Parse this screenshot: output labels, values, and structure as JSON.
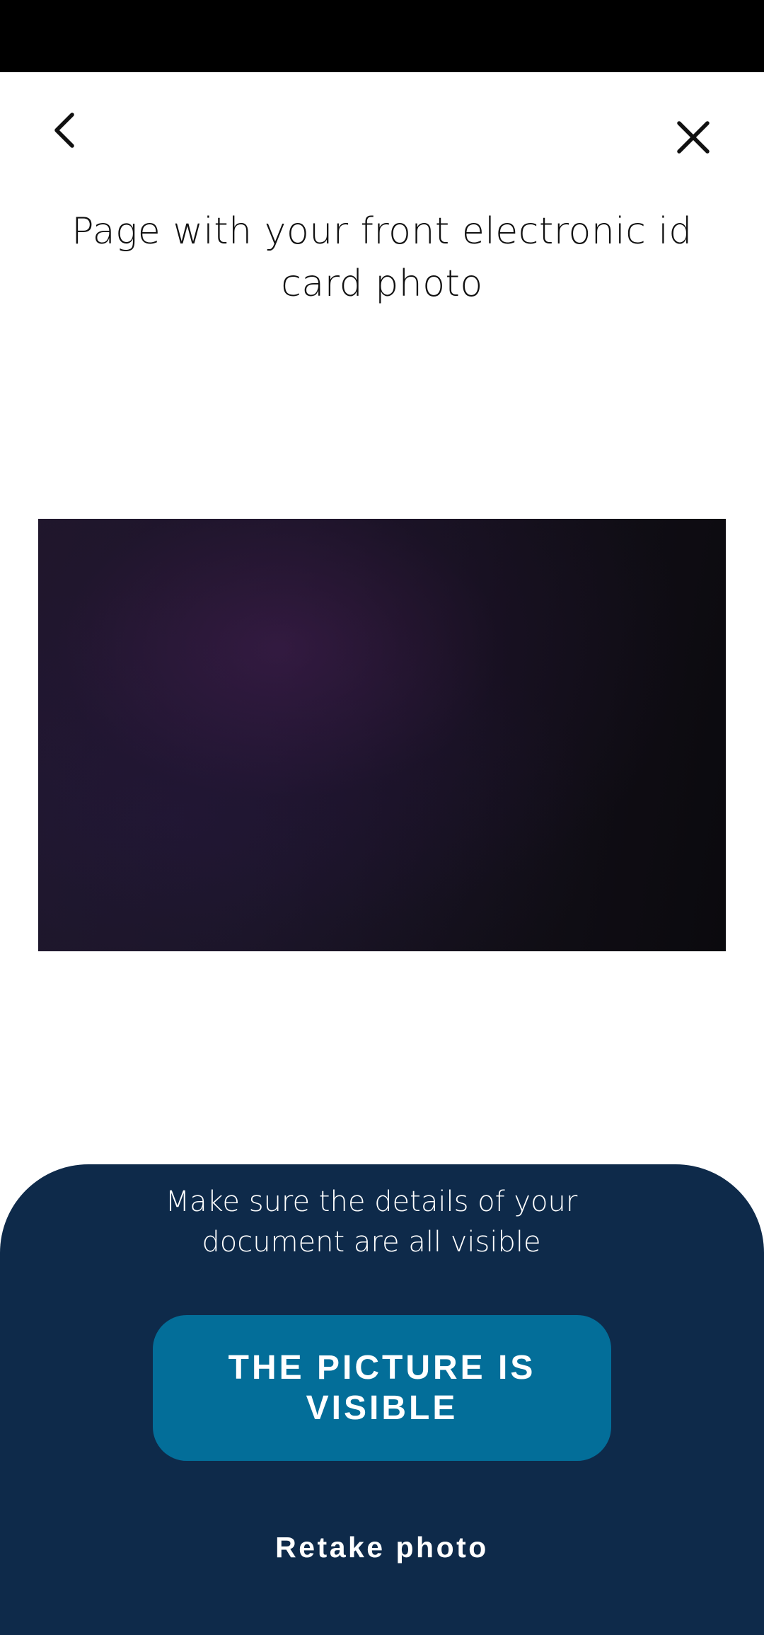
{
  "header": {
    "title": "Page with your front electronic id card photo",
    "back_icon": "chevron-left-icon",
    "close_icon": "close-icon"
  },
  "preview": {
    "description_icon": "captured-photo"
  },
  "bottom_sheet": {
    "instruction": "Make sure the details of your document are all visible",
    "confirm_label": "THE PICTURE IS VISIBLE",
    "retake_label": "Retake photo"
  },
  "colors": {
    "status_bar": "#000000",
    "background": "#ffffff",
    "sheet": "#0e2a4a",
    "primary_button": "#036e99",
    "text_dark": "#111111",
    "text_light": "#ffffff"
  }
}
